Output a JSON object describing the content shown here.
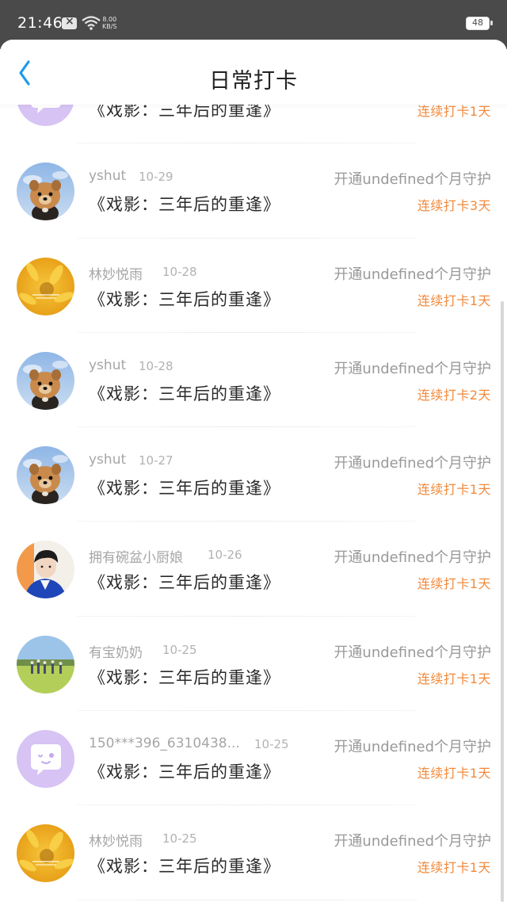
{
  "status_bar": {
    "time": "21:46",
    "speed_value": "8.00",
    "speed_unit": "KB/S",
    "battery": "48"
  },
  "header": {
    "title": "日常打卡",
    "accent_color": "#1e9be8"
  },
  "colors": {
    "streak": "#f28a3c",
    "guard": "#999999"
  },
  "items": [
    {
      "user": "",
      "date": "",
      "title": "《戏影：三年后的重逢》",
      "guard": "",
      "streak": "连续打卡1天",
      "avatar": "chat-bubble-avatar"
    },
    {
      "user": "yshut",
      "date": "10-29",
      "title": "《戏影：三年后的重逢》",
      "guard": "开通undefined个月守护",
      "streak": "连续打卡3天",
      "avatar": "dog-avatar"
    },
    {
      "user": "林妙悦雨",
      "date": "10-28",
      "title": "《戏影：三年后的重逢》",
      "guard": "开通undefined个月守护",
      "streak": "连续打卡1天",
      "avatar": "sunflower-avatar"
    },
    {
      "user": "yshut",
      "date": "10-28",
      "title": "《戏影：三年后的重逢》",
      "guard": "开通undefined个月守护",
      "streak": "连续打卡2天",
      "avatar": "dog-avatar"
    },
    {
      "user": "yshut",
      "date": "10-27",
      "title": "《戏影：三年后的重逢》",
      "guard": "开通undefined个月守护",
      "streak": "连续打卡1天",
      "avatar": "dog-avatar"
    },
    {
      "user": "拥有碗盆小厨娘",
      "date": "10-26",
      "title": "《戏影：三年后的重逢》",
      "guard": "开通undefined个月守护",
      "streak": "连续打卡1天",
      "avatar": "person-avatar"
    },
    {
      "user": "有宝奶奶",
      "date": "10-25",
      "title": "《戏影：三年后的重逢》",
      "guard": "开通undefined个月守护",
      "streak": "连续打卡1天",
      "avatar": "field-photo-avatar"
    },
    {
      "user": "150***396_6310438...",
      "date": "10-25",
      "title": "《戏影：三年后的重逢》",
      "guard": "开通undefined个月守护",
      "streak": "连续打卡1天",
      "avatar": "chat-bubble-avatar"
    },
    {
      "user": "林妙悦雨",
      "date": "10-25",
      "title": "《戏影：三年后的重逢》",
      "guard": "开通undefined个月守护",
      "streak": "连续打卡1天",
      "avatar": "sunflower-avatar"
    }
  ]
}
